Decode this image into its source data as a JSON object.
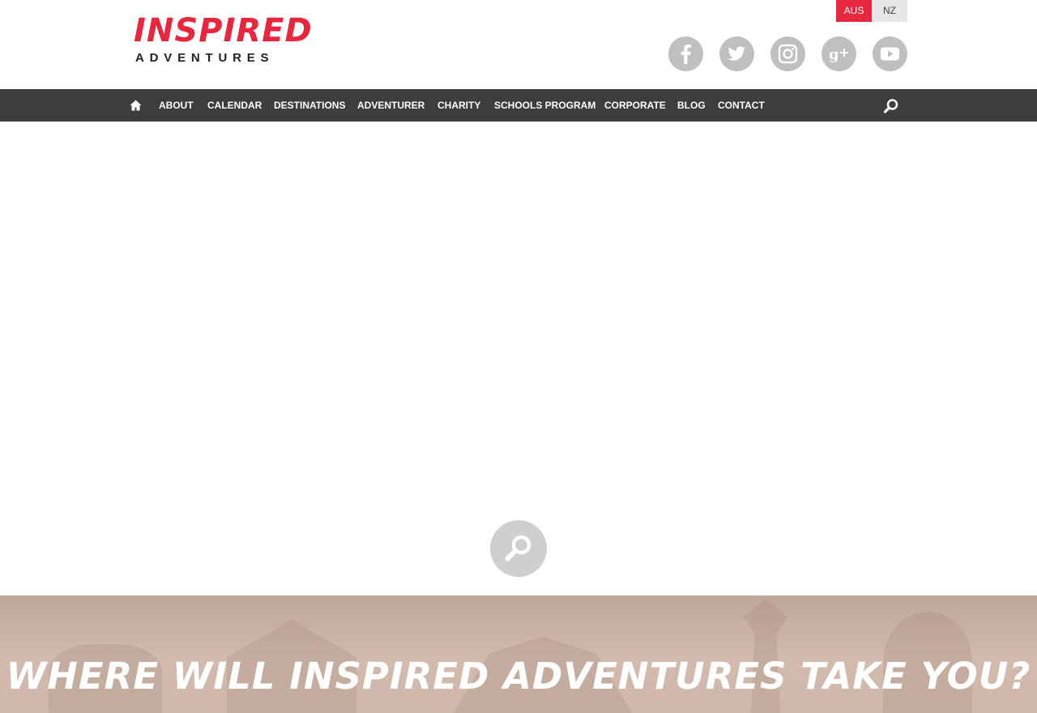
{
  "logo": {
    "line1": "INSPIRED",
    "line2": "ADVENTURES"
  },
  "regions": [
    "AUS",
    "NZ"
  ],
  "social": [
    {
      "icon": "facebook-icon"
    },
    {
      "icon": "twitter-icon"
    },
    {
      "icon": "instagram-icon"
    },
    {
      "icon": "google-plus-icon"
    },
    {
      "icon": "youtube-icon"
    }
  ],
  "nav": {
    "items": [
      "ABOUT",
      "CALENDAR",
      "DESTINATIONS",
      "ADVENTURER",
      "CHARITY",
      "SCHOOLS PROGRAM",
      "CORPORATE",
      "BLOG",
      "CONTACT"
    ]
  },
  "banner": {
    "title": "Where will Inspired Adventures take you?"
  },
  "colors": {
    "brand_red": "#e8273f",
    "nav_bg": "#3d3d3d",
    "social_grey": "#bfbfbf",
    "banner_tint": "#d1b9ac"
  }
}
